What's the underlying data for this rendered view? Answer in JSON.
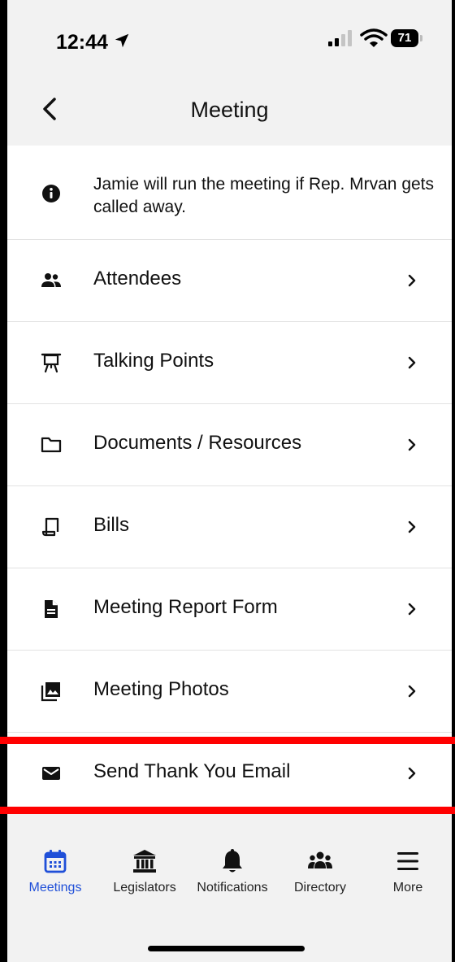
{
  "status_bar": {
    "time": "12:44",
    "battery_level": "71"
  },
  "nav": {
    "title": "Meeting"
  },
  "note": {
    "text": "Jamie will run the meeting if Rep. Mrvan gets called away."
  },
  "menu_items": [
    {
      "label": "Attendees",
      "icon": "people-icon"
    },
    {
      "label": "Talking Points",
      "icon": "presentation-easel-icon"
    },
    {
      "label": "Documents / Resources",
      "icon": "folder-icon"
    },
    {
      "label": "Bills",
      "icon": "scroll-icon"
    },
    {
      "label": "Meeting Report Form",
      "icon": "document-icon"
    },
    {
      "label": "Meeting Photos",
      "icon": "photo-library-icon"
    },
    {
      "label": "Send Thank You Email",
      "icon": "envelope-icon"
    }
  ],
  "tabs": [
    {
      "label": "Meetings",
      "icon": "calendar-icon",
      "active": true
    },
    {
      "label": "Legislators",
      "icon": "capitol-building-icon"
    },
    {
      "label": "Notifications",
      "icon": "bell-icon"
    },
    {
      "label": "Directory",
      "icon": "group-icon"
    },
    {
      "label": "More",
      "icon": "hamburger-menu-icon"
    }
  ],
  "colors": {
    "accent": "#1f4fd8",
    "highlight": "#ff0000",
    "background": "#f2f2f2",
    "text": "#111111"
  }
}
